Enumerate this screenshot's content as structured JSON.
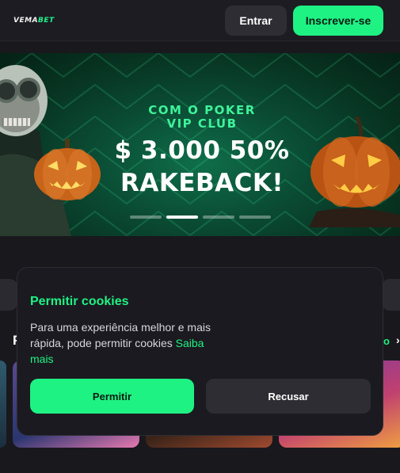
{
  "header": {
    "logo_prefix": "VEMA",
    "logo_suffix": "BET",
    "login_label": "Entrar",
    "register_label": "Inscrever-se"
  },
  "banner": {
    "subtitle_line1": "COM O POKER",
    "subtitle_line2": "VIP CLUB",
    "title_line1": "$ 3.000 50%",
    "title_line2": "RAKEBACK!",
    "slides_total": 4,
    "active_slide": 2
  },
  "section": {
    "heading_fragment": "P",
    "link_fragment": "o",
    "arrow_fragment": "›"
  },
  "cookie": {
    "title": "Permitir cookies",
    "text": "Para uma experiência melhor e mais rápida, pode permitir cookies",
    "link_label": "Saiba mais",
    "accept_label": "Permitir",
    "decline_label": "Recusar"
  },
  "colors": {
    "accent": "#1ef283",
    "background": "#19181d",
    "surface": "#2e2d34"
  }
}
